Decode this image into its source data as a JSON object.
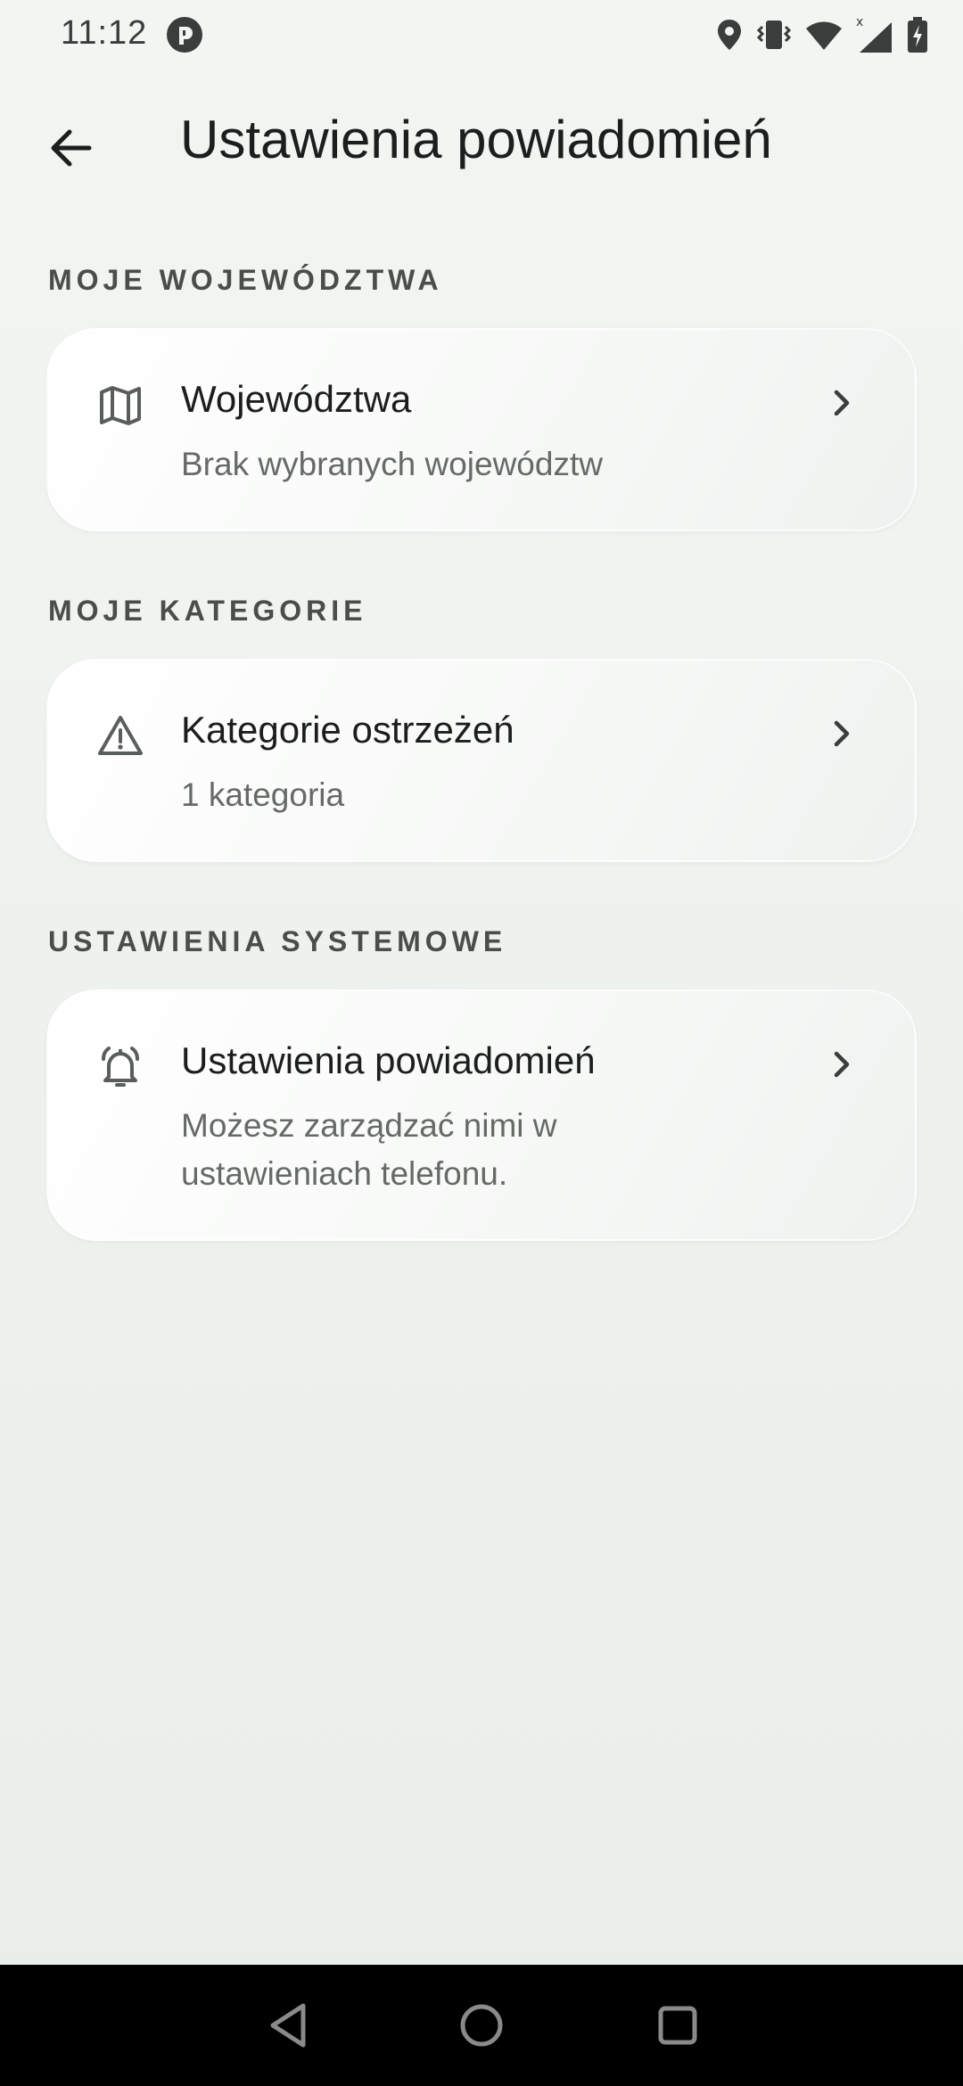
{
  "status_bar": {
    "time": "11:12",
    "icons": [
      "app-notification-icon",
      "location-icon",
      "vibrate-icon",
      "wifi-icon",
      "signal-icon",
      "battery-charging-icon"
    ]
  },
  "app_bar": {
    "title": "Ustawienia powiadomień",
    "back_icon": "arrow-back-icon"
  },
  "sections": [
    {
      "header": "MOJE WOJEWÓDZTWA",
      "card": {
        "icon": "map-icon",
        "title": "Województwa",
        "subtitle": "Brak wybranych województw"
      }
    },
    {
      "header": "MOJE KATEGORIE",
      "card": {
        "icon": "warning-icon",
        "title": "Kategorie ostrzeżeń",
        "subtitle": "1 kategoria"
      }
    },
    {
      "header": "USTAWIENIA SYSTEMOWE",
      "card": {
        "icon": "bell-icon",
        "title": "Ustawienia powiadomień",
        "subtitle": "Możesz zarządzać nimi w ustawieniach telefonu."
      }
    }
  ],
  "nav_bar": {
    "buttons": [
      "back-triangle-icon",
      "home-circle-icon",
      "recents-square-icon"
    ]
  },
  "colors": {
    "background": "#eef1ee",
    "text_primary": "#1b1e1c",
    "text_secondary": "#666a67",
    "section_header": "#4a4e4b",
    "card": "#ffffff"
  }
}
